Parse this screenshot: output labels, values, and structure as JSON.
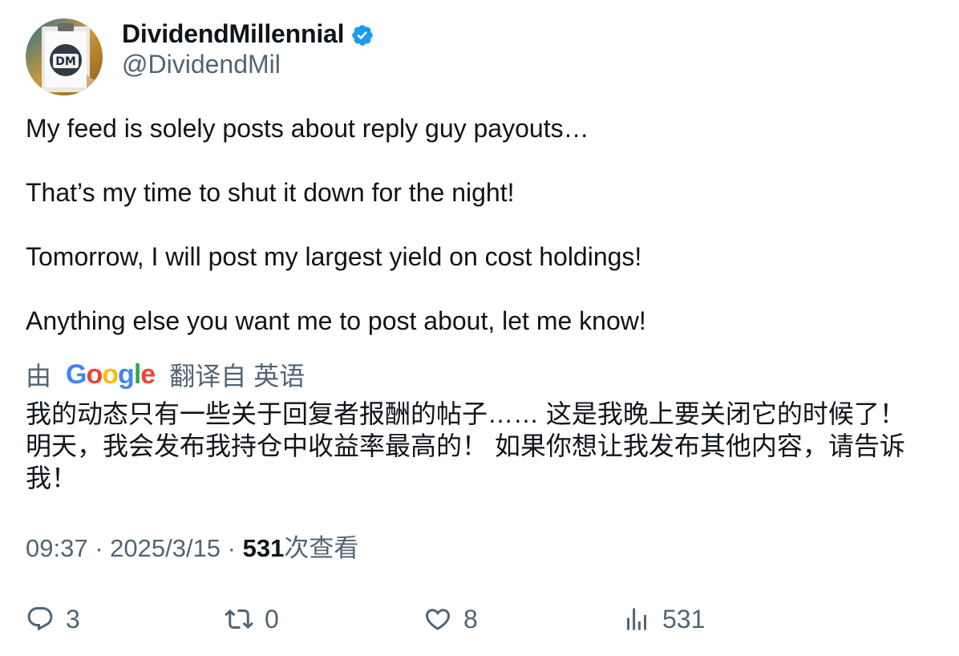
{
  "user": {
    "display_name": "DividendMillennial",
    "handle": "@DividendMil",
    "verified": true,
    "verified_color": "#1d9bf0",
    "avatar_text": "DM"
  },
  "tweet": {
    "paragraphs": [
      "My feed is solely posts about reply guy payouts…",
      "That’s my time to shut it down for the night!",
      "Tomorrow, I will post my largest yield on cost holdings!",
      "Anything else you want me to post about, let me know!"
    ]
  },
  "translation": {
    "prefix": "由",
    "provider_letters": [
      "G",
      "o",
      "o",
      "g",
      "l",
      "e"
    ],
    "suffix": "翻译自 英语",
    "text": "我的动态只有一些关于回复者报酬的帖子…… 这是我晚上要关闭它的时候了！ 明天，我会发布我持仓中收益率最高的！ 如果你想让我发布其他内容，请告诉我！"
  },
  "meta": {
    "time": "09:37",
    "separator": " · ",
    "date": "2025/3/15",
    "views_count": "531",
    "views_label": "次查看"
  },
  "actions": {
    "replies": "3",
    "reposts": "0",
    "likes": "8",
    "views": "531"
  },
  "icons": {
    "reply": "reply-icon",
    "repost": "repost-icon",
    "like": "heart-icon",
    "views": "analytics-icon",
    "verified": "verified-badge-icon"
  }
}
